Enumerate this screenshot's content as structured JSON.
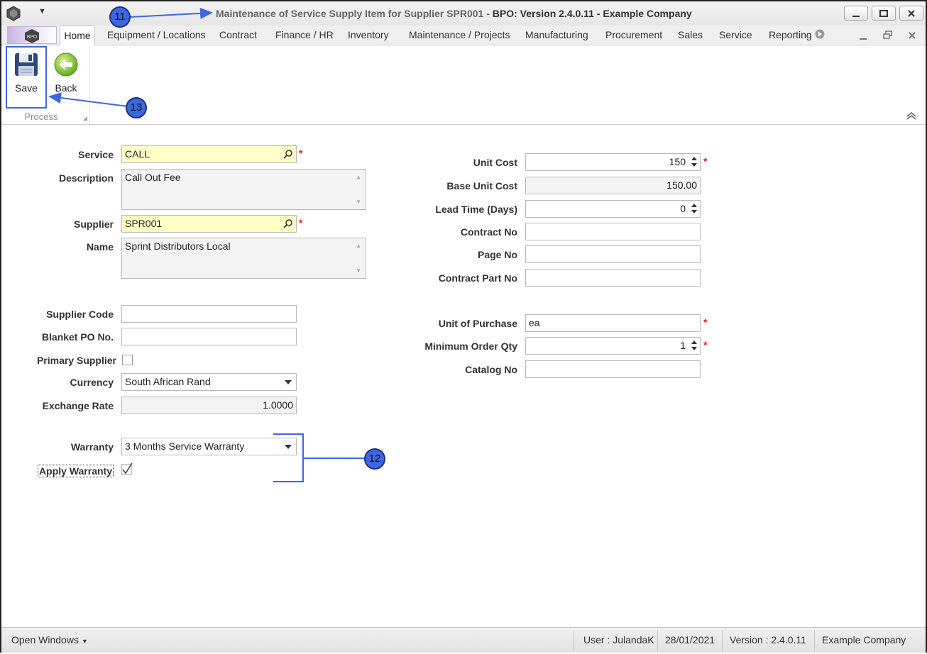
{
  "window": {
    "title_prefix": "Maintenance of Service Supply Item for Supplier SPR001 - ",
    "title_bold": "BPO: Version 2.4.0.11 - Example Company"
  },
  "menu": {
    "tabs": [
      "Home",
      "Equipment / Locations",
      "Contract",
      "Finance / HR",
      "Inventory",
      "Maintenance / Projects",
      "Manufacturing",
      "Procurement",
      "Sales",
      "Service",
      "Reporting"
    ]
  },
  "ribbon": {
    "save_label": "Save",
    "back_label": "Back",
    "group_label": "Process"
  },
  "form": {
    "service_label": "Service",
    "service_value": "CALL",
    "description_label": "Description",
    "description_value": "Call Out Fee",
    "supplier_label": "Supplier",
    "supplier_value": "SPR001",
    "name_label": "Name",
    "name_value": "Sprint Distributors Local",
    "supplier_code_label": "Supplier Code",
    "supplier_code_value": "",
    "blanket_po_label": "Blanket PO No.",
    "blanket_po_value": "",
    "primary_supplier_label": "Primary Supplier",
    "primary_supplier_checked": false,
    "currency_label": "Currency",
    "currency_value": "South African Rand",
    "exchange_rate_label": "Exchange Rate",
    "exchange_rate_value": "1.0000",
    "warranty_label": "Warranty",
    "warranty_value": "3 Months Service Warranty",
    "apply_warranty_label": "Apply Warranty",
    "apply_warranty_checked": true,
    "unit_cost_label": "Unit Cost",
    "unit_cost_value": "150",
    "base_unit_cost_label": "Base Unit Cost",
    "base_unit_cost_value": "150.00",
    "lead_time_label": "Lead Time (Days)",
    "lead_time_value": "0",
    "contract_no_label": "Contract No",
    "contract_no_value": "",
    "page_no_label": "Page No",
    "page_no_value": "",
    "contract_part_no_label": "Contract Part No",
    "contract_part_no_value": "",
    "unit_of_purchase_label": "Unit of Purchase",
    "unit_of_purchase_value": "ea",
    "min_order_qty_label": "Minimum Order Qty",
    "min_order_qty_value": "1",
    "catalog_no_label": "Catalog No",
    "catalog_no_value": "",
    "required_marker": "*"
  },
  "callouts": [
    "11",
    "12",
    "13"
  ],
  "status": {
    "open_windows": "Open Windows",
    "user": "User : JulandaK",
    "date": "28/01/2021",
    "version": "Version : 2.4.0.11",
    "company": "Example Company"
  },
  "colors": {
    "required_field": "#ffffc8",
    "required_marker": "#e02020",
    "annotation": "#3d67e0"
  }
}
